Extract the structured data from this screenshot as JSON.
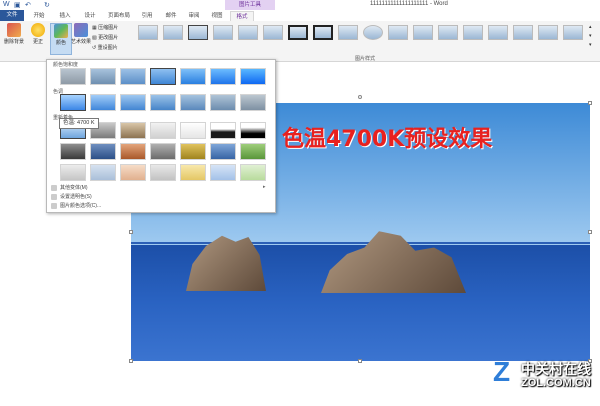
{
  "window": {
    "title": "11111111111111111111 - Word",
    "context_tab_group": "图片工具"
  },
  "tabs": [
    {
      "label": "文件"
    },
    {
      "label": "开始"
    },
    {
      "label": "插入"
    },
    {
      "label": "设计"
    },
    {
      "label": "页面布局"
    },
    {
      "label": "引用"
    },
    {
      "label": "邮件"
    },
    {
      "label": "审阅"
    },
    {
      "label": "视图"
    },
    {
      "label": "格式"
    }
  ],
  "ribbon": {
    "remove_bg": "删除背景",
    "corrections": "更正",
    "color": "颜色",
    "artistic": "艺术效果",
    "compress": "压缩图片",
    "change": "更改图片",
    "reset": "重设图片",
    "styles_group": "图片样式"
  },
  "color_menu": {
    "saturation_title": "颜色饱和度",
    "tone_title": "色调",
    "recolor_title": "重新着色",
    "tooltip": "色温: 4700 K",
    "more_variations": "其他变体(M)",
    "set_transparent": "设置透明色(S)",
    "color_options": "图片颜色选项(C)..."
  },
  "document": {
    "headline": "色温4700K预设效果"
  },
  "watermark": {
    "brand": "中关村在线",
    "url": "ZOL.COM.CN"
  },
  "colors": {
    "accent": "#2b579a",
    "picture_tools": "#6b2d99",
    "headline": "#e8211f"
  }
}
